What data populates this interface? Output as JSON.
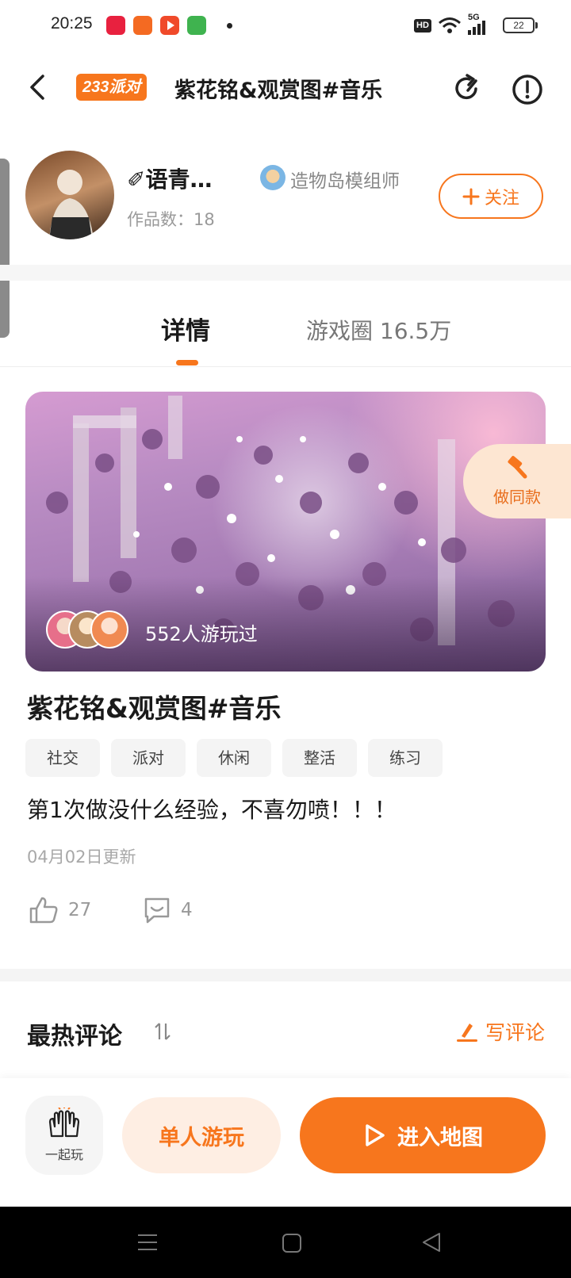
{
  "status_bar": {
    "time": "20:25",
    "network": "HD",
    "signal": "5G",
    "battery": "22"
  },
  "header": {
    "badge": "233派对",
    "title": "紫花铭&观赏图#音乐"
  },
  "creator": {
    "name": "✐语青…",
    "role": "造物岛模组师",
    "works": "作品数：18",
    "follow_label": "关注"
  },
  "tabs": {
    "detail": "详情",
    "circle": "游戏圈 16.5万"
  },
  "preview": {
    "players": "552人游玩过",
    "remix_label": "做同款"
  },
  "game": {
    "title": "紫花铭&观赏图#音乐",
    "tags": [
      "社交",
      "派对",
      "休闲",
      "整活",
      "练习"
    ],
    "description": "第1次做没什么经验，不喜勿喷！！！",
    "updated": "04月02日更新",
    "likes": "27",
    "comments": "4"
  },
  "comments_section": {
    "title": "最热评论",
    "write_label": "写评论"
  },
  "bottom": {
    "together": "一起玩",
    "solo": "单人游玩",
    "enter": "进入地图"
  },
  "colors": {
    "accent": "#f7761d",
    "accent_light": "#feeee3"
  }
}
